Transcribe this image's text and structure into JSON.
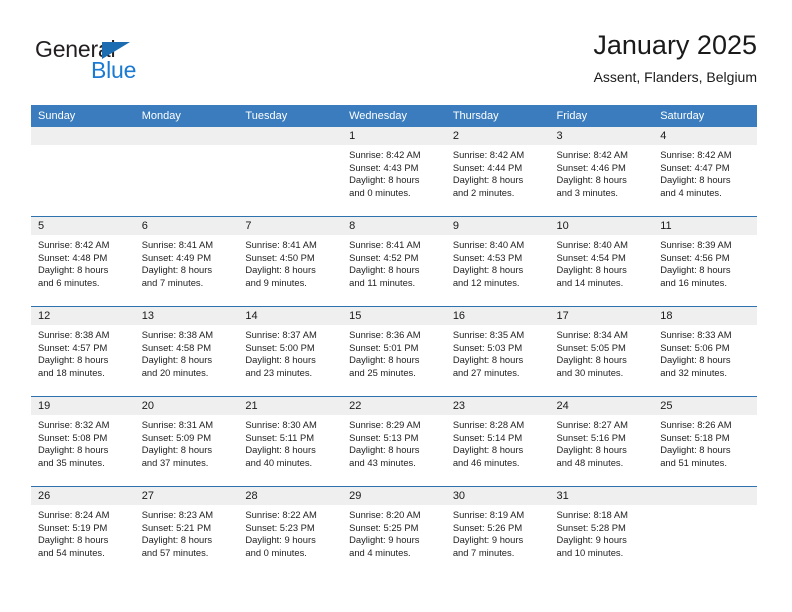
{
  "brand": {
    "name_part1": "General",
    "name_part2": "Blue",
    "triangle_icon": "triangle-icon",
    "colors": {
      "general_text": "#231f20",
      "blue_text": "#1b7ad1",
      "triangle": "#1b6cb0"
    }
  },
  "header": {
    "title": "January 2025",
    "subtitle": "Assent, Flanders, Belgium"
  },
  "theme": {
    "header_bg": "#3a7cbe",
    "week_divider": "#2e72b0",
    "daynum_band_bg": "#efefef",
    "body_bg": "#ffffff",
    "text": "#1a1a1a"
  },
  "calendar": {
    "weekday_headers": [
      "Sunday",
      "Monday",
      "Tuesday",
      "Wednesday",
      "Thursday",
      "Friday",
      "Saturday"
    ],
    "weeks": [
      [
        {
          "day": "",
          "sunrise": "",
          "sunset": "",
          "daylight_line1": "",
          "daylight_line2": ""
        },
        {
          "day": "",
          "sunrise": "",
          "sunset": "",
          "daylight_line1": "",
          "daylight_line2": ""
        },
        {
          "day": "",
          "sunrise": "",
          "sunset": "",
          "daylight_line1": "",
          "daylight_line2": ""
        },
        {
          "day": "1",
          "sunrise": "Sunrise: 8:42 AM",
          "sunset": "Sunset: 4:43 PM",
          "daylight_line1": "Daylight: 8 hours",
          "daylight_line2": "and 0 minutes."
        },
        {
          "day": "2",
          "sunrise": "Sunrise: 8:42 AM",
          "sunset": "Sunset: 4:44 PM",
          "daylight_line1": "Daylight: 8 hours",
          "daylight_line2": "and 2 minutes."
        },
        {
          "day": "3",
          "sunrise": "Sunrise: 8:42 AM",
          "sunset": "Sunset: 4:46 PM",
          "daylight_line1": "Daylight: 8 hours",
          "daylight_line2": "and 3 minutes."
        },
        {
          "day": "4",
          "sunrise": "Sunrise: 8:42 AM",
          "sunset": "Sunset: 4:47 PM",
          "daylight_line1": "Daylight: 8 hours",
          "daylight_line2": "and 4 minutes."
        }
      ],
      [
        {
          "day": "5",
          "sunrise": "Sunrise: 8:42 AM",
          "sunset": "Sunset: 4:48 PM",
          "daylight_line1": "Daylight: 8 hours",
          "daylight_line2": "and 6 minutes."
        },
        {
          "day": "6",
          "sunrise": "Sunrise: 8:41 AM",
          "sunset": "Sunset: 4:49 PM",
          "daylight_line1": "Daylight: 8 hours",
          "daylight_line2": "and 7 minutes."
        },
        {
          "day": "7",
          "sunrise": "Sunrise: 8:41 AM",
          "sunset": "Sunset: 4:50 PM",
          "daylight_line1": "Daylight: 8 hours",
          "daylight_line2": "and 9 minutes."
        },
        {
          "day": "8",
          "sunrise": "Sunrise: 8:41 AM",
          "sunset": "Sunset: 4:52 PM",
          "daylight_line1": "Daylight: 8 hours",
          "daylight_line2": "and 11 minutes."
        },
        {
          "day": "9",
          "sunrise": "Sunrise: 8:40 AM",
          "sunset": "Sunset: 4:53 PM",
          "daylight_line1": "Daylight: 8 hours",
          "daylight_line2": "and 12 minutes."
        },
        {
          "day": "10",
          "sunrise": "Sunrise: 8:40 AM",
          "sunset": "Sunset: 4:54 PM",
          "daylight_line1": "Daylight: 8 hours",
          "daylight_line2": "and 14 minutes."
        },
        {
          "day": "11",
          "sunrise": "Sunrise: 8:39 AM",
          "sunset": "Sunset: 4:56 PM",
          "daylight_line1": "Daylight: 8 hours",
          "daylight_line2": "and 16 minutes."
        }
      ],
      [
        {
          "day": "12",
          "sunrise": "Sunrise: 8:38 AM",
          "sunset": "Sunset: 4:57 PM",
          "daylight_line1": "Daylight: 8 hours",
          "daylight_line2": "and 18 minutes."
        },
        {
          "day": "13",
          "sunrise": "Sunrise: 8:38 AM",
          "sunset": "Sunset: 4:58 PM",
          "daylight_line1": "Daylight: 8 hours",
          "daylight_line2": "and 20 minutes."
        },
        {
          "day": "14",
          "sunrise": "Sunrise: 8:37 AM",
          "sunset": "Sunset: 5:00 PM",
          "daylight_line1": "Daylight: 8 hours",
          "daylight_line2": "and 23 minutes."
        },
        {
          "day": "15",
          "sunrise": "Sunrise: 8:36 AM",
          "sunset": "Sunset: 5:01 PM",
          "daylight_line1": "Daylight: 8 hours",
          "daylight_line2": "and 25 minutes."
        },
        {
          "day": "16",
          "sunrise": "Sunrise: 8:35 AM",
          "sunset": "Sunset: 5:03 PM",
          "daylight_line1": "Daylight: 8 hours",
          "daylight_line2": "and 27 minutes."
        },
        {
          "day": "17",
          "sunrise": "Sunrise: 8:34 AM",
          "sunset": "Sunset: 5:05 PM",
          "daylight_line1": "Daylight: 8 hours",
          "daylight_line2": "and 30 minutes."
        },
        {
          "day": "18",
          "sunrise": "Sunrise: 8:33 AM",
          "sunset": "Sunset: 5:06 PM",
          "daylight_line1": "Daylight: 8 hours",
          "daylight_line2": "and 32 minutes."
        }
      ],
      [
        {
          "day": "19",
          "sunrise": "Sunrise: 8:32 AM",
          "sunset": "Sunset: 5:08 PM",
          "daylight_line1": "Daylight: 8 hours",
          "daylight_line2": "and 35 minutes."
        },
        {
          "day": "20",
          "sunrise": "Sunrise: 8:31 AM",
          "sunset": "Sunset: 5:09 PM",
          "daylight_line1": "Daylight: 8 hours",
          "daylight_line2": "and 37 minutes."
        },
        {
          "day": "21",
          "sunrise": "Sunrise: 8:30 AM",
          "sunset": "Sunset: 5:11 PM",
          "daylight_line1": "Daylight: 8 hours",
          "daylight_line2": "and 40 minutes."
        },
        {
          "day": "22",
          "sunrise": "Sunrise: 8:29 AM",
          "sunset": "Sunset: 5:13 PM",
          "daylight_line1": "Daylight: 8 hours",
          "daylight_line2": "and 43 minutes."
        },
        {
          "day": "23",
          "sunrise": "Sunrise: 8:28 AM",
          "sunset": "Sunset: 5:14 PM",
          "daylight_line1": "Daylight: 8 hours",
          "daylight_line2": "and 46 minutes."
        },
        {
          "day": "24",
          "sunrise": "Sunrise: 8:27 AM",
          "sunset": "Sunset: 5:16 PM",
          "daylight_line1": "Daylight: 8 hours",
          "daylight_line2": "and 48 minutes."
        },
        {
          "day": "25",
          "sunrise": "Sunrise: 8:26 AM",
          "sunset": "Sunset: 5:18 PM",
          "daylight_line1": "Daylight: 8 hours",
          "daylight_line2": "and 51 minutes."
        }
      ],
      [
        {
          "day": "26",
          "sunrise": "Sunrise: 8:24 AM",
          "sunset": "Sunset: 5:19 PM",
          "daylight_line1": "Daylight: 8 hours",
          "daylight_line2": "and 54 minutes."
        },
        {
          "day": "27",
          "sunrise": "Sunrise: 8:23 AM",
          "sunset": "Sunset: 5:21 PM",
          "daylight_line1": "Daylight: 8 hours",
          "daylight_line2": "and 57 minutes."
        },
        {
          "day": "28",
          "sunrise": "Sunrise: 8:22 AM",
          "sunset": "Sunset: 5:23 PM",
          "daylight_line1": "Daylight: 9 hours",
          "daylight_line2": "and 0 minutes."
        },
        {
          "day": "29",
          "sunrise": "Sunrise: 8:20 AM",
          "sunset": "Sunset: 5:25 PM",
          "daylight_line1": "Daylight: 9 hours",
          "daylight_line2": "and 4 minutes."
        },
        {
          "day": "30",
          "sunrise": "Sunrise: 8:19 AM",
          "sunset": "Sunset: 5:26 PM",
          "daylight_line1": "Daylight: 9 hours",
          "daylight_line2": "and 7 minutes."
        },
        {
          "day": "31",
          "sunrise": "Sunrise: 8:18 AM",
          "sunset": "Sunset: 5:28 PM",
          "daylight_line1": "Daylight: 9 hours",
          "daylight_line2": "and 10 minutes."
        },
        {
          "day": "",
          "sunrise": "",
          "sunset": "",
          "daylight_line1": "",
          "daylight_line2": ""
        }
      ]
    ]
  }
}
